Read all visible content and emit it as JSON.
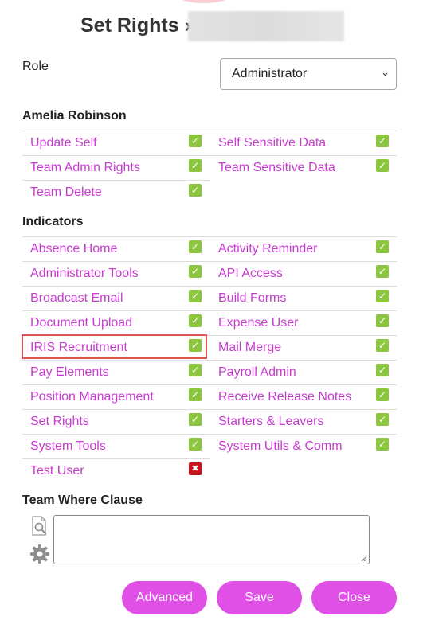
{
  "dialog": {
    "title": "Set Rights »",
    "role_label": "Role",
    "role_value": "Administrator"
  },
  "user_section": {
    "title": "Amelia Robinson",
    "rows": [
      {
        "left": {
          "label": "Update Self",
          "checked": true
        },
        "right": {
          "label": "Self Sensitive Data",
          "checked": true
        }
      },
      {
        "left": {
          "label": "Team Admin Rights",
          "checked": true
        },
        "right": {
          "label": "Team Sensitive Data",
          "checked": true
        }
      },
      {
        "left": {
          "label": "Team Delete",
          "checked": true
        },
        "right": null
      }
    ]
  },
  "indicators_section": {
    "title": "Indicators",
    "rows": [
      {
        "left": {
          "label": "Absence Home",
          "checked": true
        },
        "right": {
          "label": "Activity Reminder",
          "checked": true
        }
      },
      {
        "left": {
          "label": "Administrator Tools",
          "checked": true
        },
        "right": {
          "label": "API Access",
          "checked": true
        }
      },
      {
        "left": {
          "label": "Broadcast Email",
          "checked": true
        },
        "right": {
          "label": "Build Forms",
          "checked": true
        }
      },
      {
        "left": {
          "label": "Document Upload",
          "checked": true
        },
        "right": {
          "label": "Expense User",
          "checked": true
        }
      },
      {
        "left": {
          "label": "IRIS Recruitment",
          "checked": true
        },
        "right": {
          "label": "Mail Merge",
          "checked": true
        }
      },
      {
        "left": {
          "label": "Pay Elements",
          "checked": true
        },
        "right": {
          "label": "Payroll Admin",
          "checked": true
        }
      },
      {
        "left": {
          "label": "Position Management",
          "checked": true
        },
        "right": {
          "label": "Receive Release Notes",
          "checked": true
        }
      },
      {
        "left": {
          "label": "Set Rights",
          "checked": true
        },
        "right": {
          "label": "Starters & Leavers",
          "checked": true
        }
      },
      {
        "left": {
          "label": "System Tools",
          "checked": true
        },
        "right": {
          "label": "System Utils & Comm",
          "checked": true
        }
      },
      {
        "left": {
          "label": "Test User",
          "checked": false
        },
        "right": null
      }
    ]
  },
  "highlighted_item": "IRIS Recruitment",
  "team_where": {
    "title": "Team Where Clause",
    "value": ""
  },
  "buttons": {
    "advanced": "Advanced",
    "save": "Save",
    "close": "Close"
  },
  "colors": {
    "link": "#c83cd0",
    "check_on": "#8cc63f",
    "check_off": "#c8141e",
    "button": "#e04fe6",
    "highlight": "#e0534e"
  },
  "icons": {
    "checked": "checkmark-icon",
    "unchecked": "cross-icon",
    "view": "document-search-icon",
    "settings": "gear-icon"
  }
}
